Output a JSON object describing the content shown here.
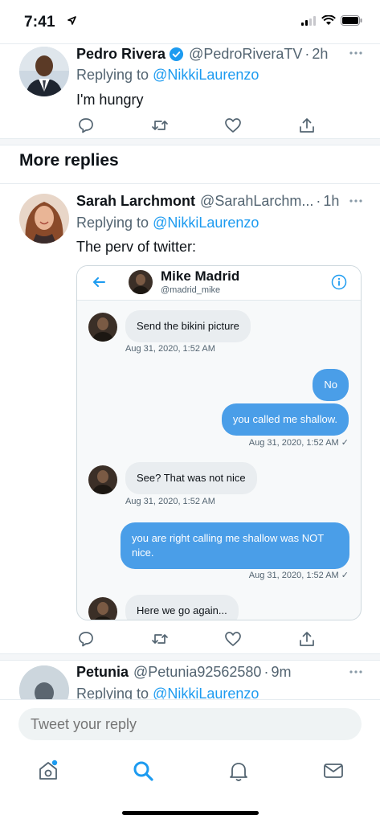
{
  "status_bar": {
    "time": "7:41"
  },
  "tweets": [
    {
      "name": "Pedro Rivera",
      "verified": true,
      "handle": "@PedroRiveraTV",
      "time": "2h",
      "replying_prefix": "Replying to",
      "replying_to": "@NikkiLaurenzo",
      "text": "I'm hungry"
    },
    {
      "name": "Sarah Larchmont",
      "handle": "@SarahLarchm...",
      "time": "1h",
      "replying_prefix": "Replying to",
      "replying_to": "@NikkiLaurenzo",
      "text": "The perv of twitter:"
    },
    {
      "name": "Petunia",
      "handle": "@Petunia92562580",
      "time": "9m",
      "replying_prefix": "Replying to",
      "replying_to": "@NikkiLaurenzo"
    }
  ],
  "more_replies_title": "More replies",
  "dm": {
    "name": "Mike Madrid",
    "handle": "@madrid_mike",
    "messages": [
      {
        "dir": "in",
        "text": "Send the bikini picture",
        "stamp": "Aug 31, 2020, 1:52 AM"
      },
      {
        "dir": "out",
        "text": "No"
      },
      {
        "dir": "out",
        "text": "you called me shallow.",
        "stamp": "Aug 31, 2020, 1:52 AM ✓"
      },
      {
        "dir": "in",
        "text": "See? That was not nice",
        "stamp": "Aug 31, 2020, 1:52 AM"
      },
      {
        "dir": "out",
        "text": "you are right calling me shallow was NOT nice.",
        "stamp": "Aug 31, 2020, 1:52 AM ✓"
      },
      {
        "dir": "in",
        "text": "Here we go again..."
      }
    ]
  },
  "reply_box": {
    "placeholder": "Tweet your reply"
  },
  "nav": {
    "items": [
      "home-icon",
      "search-icon",
      "notifications-icon",
      "messages-icon"
    ]
  },
  "colors": {
    "accent": "#1d9bf0",
    "dm_bubble_out": "#4a9ee8"
  }
}
